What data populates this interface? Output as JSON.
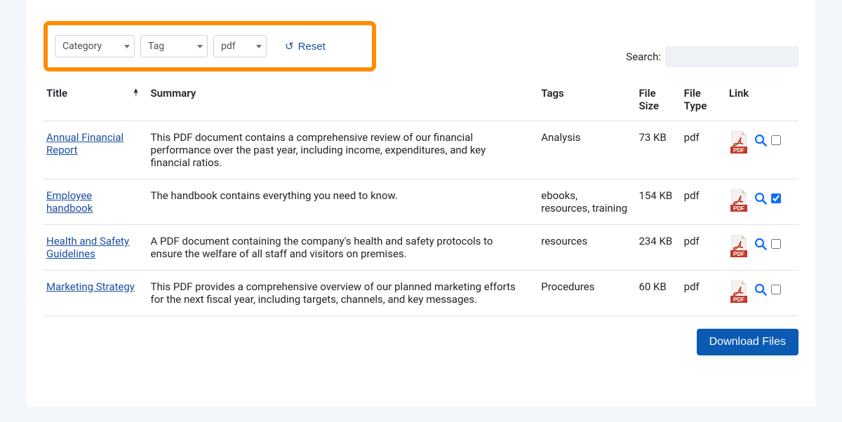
{
  "filters": {
    "category": "Category",
    "tag": "Tag",
    "filetype": "pdf",
    "reset": "Reset"
  },
  "search": {
    "label": "Search:",
    "value": ""
  },
  "columns": {
    "title": "Title",
    "summary": "Summary",
    "tags": "Tags",
    "size": "File Size",
    "type": "File Type",
    "link": "Link"
  },
  "rows": [
    {
      "title": "Annual Financial Report",
      "summary": "This PDF document contains a comprehensive review of our financial performance over the past year, including income, expenditures, and key financial ratios.",
      "tags": "Analysis",
      "size": "73 KB",
      "type": "pdf",
      "checked": false
    },
    {
      "title": "Employee handbook",
      "summary": "The handbook contains everything you need to know.",
      "tags": "ebooks, resources, training",
      "size": "154 KB",
      "type": "pdf",
      "checked": true
    },
    {
      "title": "Health and Safety Guidelines",
      "summary": "A PDF document containing the company's health and safety protocols to ensure the welfare of all staff and visitors on premises.",
      "tags": "resources",
      "size": "234 KB",
      "type": "pdf",
      "checked": false
    },
    {
      "title": "Marketing Strategy",
      "summary": "This PDF provides a comprehensive overview of our planned marketing efforts for the next fiscal year, including targets, channels, and key messages.",
      "tags": "Procedures",
      "size": "60 KB",
      "type": "pdf",
      "checked": false
    }
  ],
  "downloadLabel": "Download Files"
}
